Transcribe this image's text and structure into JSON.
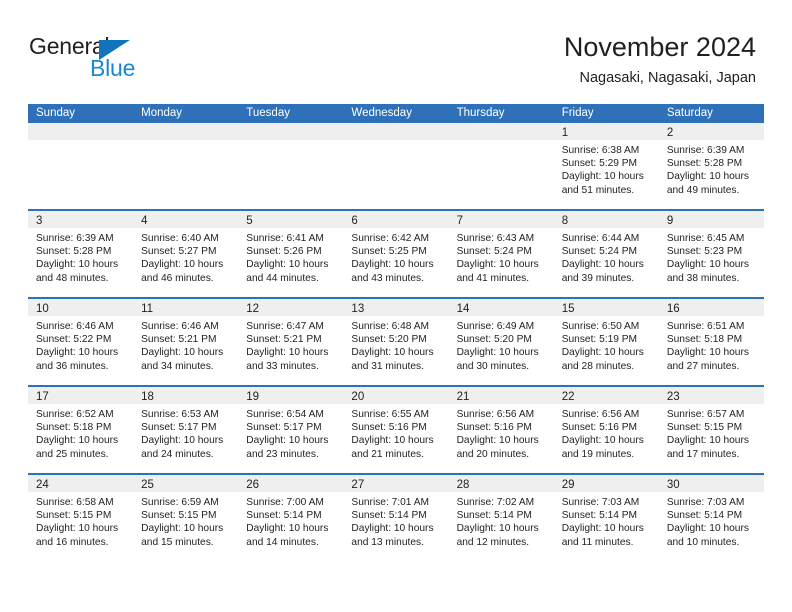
{
  "brand": {
    "name_part1": "General",
    "name_part2": "Blue",
    "triangle_color": "#1173bb",
    "blue_color": "#1b87d3"
  },
  "header": {
    "title": "November 2024",
    "subtitle": "Nagasaki, Nagasaki, Japan"
  },
  "colors": {
    "header_bar": "#2e71b8",
    "day_head": "#efefef",
    "text": "#231f20"
  },
  "weekdays": [
    "Sunday",
    "Monday",
    "Tuesday",
    "Wednesday",
    "Thursday",
    "Friday",
    "Saturday"
  ],
  "weeks": [
    [
      {
        "empty": true
      },
      {
        "empty": true
      },
      {
        "empty": true
      },
      {
        "empty": true
      },
      {
        "empty": true
      },
      {
        "day": "1",
        "sunrise": "Sunrise: 6:38 AM",
        "sunset": "Sunset: 5:29 PM",
        "daylight1": "Daylight: 10 hours",
        "daylight2": "and 51 minutes."
      },
      {
        "day": "2",
        "sunrise": "Sunrise: 6:39 AM",
        "sunset": "Sunset: 5:28 PM",
        "daylight1": "Daylight: 10 hours",
        "daylight2": "and 49 minutes."
      }
    ],
    [
      {
        "day": "3",
        "sunrise": "Sunrise: 6:39 AM",
        "sunset": "Sunset: 5:28 PM",
        "daylight1": "Daylight: 10 hours",
        "daylight2": "and 48 minutes."
      },
      {
        "day": "4",
        "sunrise": "Sunrise: 6:40 AM",
        "sunset": "Sunset: 5:27 PM",
        "daylight1": "Daylight: 10 hours",
        "daylight2": "and 46 minutes."
      },
      {
        "day": "5",
        "sunrise": "Sunrise: 6:41 AM",
        "sunset": "Sunset: 5:26 PM",
        "daylight1": "Daylight: 10 hours",
        "daylight2": "and 44 minutes."
      },
      {
        "day": "6",
        "sunrise": "Sunrise: 6:42 AM",
        "sunset": "Sunset: 5:25 PM",
        "daylight1": "Daylight: 10 hours",
        "daylight2": "and 43 minutes."
      },
      {
        "day": "7",
        "sunrise": "Sunrise: 6:43 AM",
        "sunset": "Sunset: 5:24 PM",
        "daylight1": "Daylight: 10 hours",
        "daylight2": "and 41 minutes."
      },
      {
        "day": "8",
        "sunrise": "Sunrise: 6:44 AM",
        "sunset": "Sunset: 5:24 PM",
        "daylight1": "Daylight: 10 hours",
        "daylight2": "and 39 minutes."
      },
      {
        "day": "9",
        "sunrise": "Sunrise: 6:45 AM",
        "sunset": "Sunset: 5:23 PM",
        "daylight1": "Daylight: 10 hours",
        "daylight2": "and 38 minutes."
      }
    ],
    [
      {
        "day": "10",
        "sunrise": "Sunrise: 6:46 AM",
        "sunset": "Sunset: 5:22 PM",
        "daylight1": "Daylight: 10 hours",
        "daylight2": "and 36 minutes."
      },
      {
        "day": "11",
        "sunrise": "Sunrise: 6:46 AM",
        "sunset": "Sunset: 5:21 PM",
        "daylight1": "Daylight: 10 hours",
        "daylight2": "and 34 minutes."
      },
      {
        "day": "12",
        "sunrise": "Sunrise: 6:47 AM",
        "sunset": "Sunset: 5:21 PM",
        "daylight1": "Daylight: 10 hours",
        "daylight2": "and 33 minutes."
      },
      {
        "day": "13",
        "sunrise": "Sunrise: 6:48 AM",
        "sunset": "Sunset: 5:20 PM",
        "daylight1": "Daylight: 10 hours",
        "daylight2": "and 31 minutes."
      },
      {
        "day": "14",
        "sunrise": "Sunrise: 6:49 AM",
        "sunset": "Sunset: 5:20 PM",
        "daylight1": "Daylight: 10 hours",
        "daylight2": "and 30 minutes."
      },
      {
        "day": "15",
        "sunrise": "Sunrise: 6:50 AM",
        "sunset": "Sunset: 5:19 PM",
        "daylight1": "Daylight: 10 hours",
        "daylight2": "and 28 minutes."
      },
      {
        "day": "16",
        "sunrise": "Sunrise: 6:51 AM",
        "sunset": "Sunset: 5:18 PM",
        "daylight1": "Daylight: 10 hours",
        "daylight2": "and 27 minutes."
      }
    ],
    [
      {
        "day": "17",
        "sunrise": "Sunrise: 6:52 AM",
        "sunset": "Sunset: 5:18 PM",
        "daylight1": "Daylight: 10 hours",
        "daylight2": "and 25 minutes."
      },
      {
        "day": "18",
        "sunrise": "Sunrise: 6:53 AM",
        "sunset": "Sunset: 5:17 PM",
        "daylight1": "Daylight: 10 hours",
        "daylight2": "and 24 minutes."
      },
      {
        "day": "19",
        "sunrise": "Sunrise: 6:54 AM",
        "sunset": "Sunset: 5:17 PM",
        "daylight1": "Daylight: 10 hours",
        "daylight2": "and 23 minutes."
      },
      {
        "day": "20",
        "sunrise": "Sunrise: 6:55 AM",
        "sunset": "Sunset: 5:16 PM",
        "daylight1": "Daylight: 10 hours",
        "daylight2": "and 21 minutes."
      },
      {
        "day": "21",
        "sunrise": "Sunrise: 6:56 AM",
        "sunset": "Sunset: 5:16 PM",
        "daylight1": "Daylight: 10 hours",
        "daylight2": "and 20 minutes."
      },
      {
        "day": "22",
        "sunrise": "Sunrise: 6:56 AM",
        "sunset": "Sunset: 5:16 PM",
        "daylight1": "Daylight: 10 hours",
        "daylight2": "and 19 minutes."
      },
      {
        "day": "23",
        "sunrise": "Sunrise: 6:57 AM",
        "sunset": "Sunset: 5:15 PM",
        "daylight1": "Daylight: 10 hours",
        "daylight2": "and 17 minutes."
      }
    ],
    [
      {
        "day": "24",
        "sunrise": "Sunrise: 6:58 AM",
        "sunset": "Sunset: 5:15 PM",
        "daylight1": "Daylight: 10 hours",
        "daylight2": "and 16 minutes."
      },
      {
        "day": "25",
        "sunrise": "Sunrise: 6:59 AM",
        "sunset": "Sunset: 5:15 PM",
        "daylight1": "Daylight: 10 hours",
        "daylight2": "and 15 minutes."
      },
      {
        "day": "26",
        "sunrise": "Sunrise: 7:00 AM",
        "sunset": "Sunset: 5:14 PM",
        "daylight1": "Daylight: 10 hours",
        "daylight2": "and 14 minutes."
      },
      {
        "day": "27",
        "sunrise": "Sunrise: 7:01 AM",
        "sunset": "Sunset: 5:14 PM",
        "daylight1": "Daylight: 10 hours",
        "daylight2": "and 13 minutes."
      },
      {
        "day": "28",
        "sunrise": "Sunrise: 7:02 AM",
        "sunset": "Sunset: 5:14 PM",
        "daylight1": "Daylight: 10 hours",
        "daylight2": "and 12 minutes."
      },
      {
        "day": "29",
        "sunrise": "Sunrise: 7:03 AM",
        "sunset": "Sunset: 5:14 PM",
        "daylight1": "Daylight: 10 hours",
        "daylight2": "and 11 minutes."
      },
      {
        "day": "30",
        "sunrise": "Sunrise: 7:03 AM",
        "sunset": "Sunset: 5:14 PM",
        "daylight1": "Daylight: 10 hours",
        "daylight2": "and 10 minutes."
      }
    ]
  ]
}
